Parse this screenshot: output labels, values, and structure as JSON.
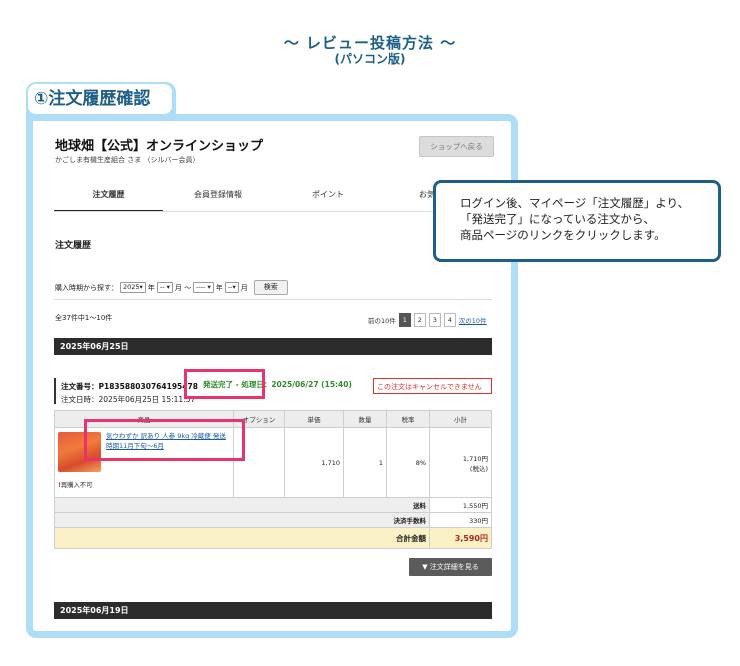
{
  "header": {
    "title": "～ レビュー投稿方法 ～",
    "subtitle": "(パソコン版)"
  },
  "step_label": "①注文履歴確認",
  "shop": {
    "title": "地球畑【公式】オンラインショップ",
    "subtitle": "かごしま有機生産組合 さま （シルバー会員）",
    "back_button": "ショップへ戻る",
    "tabs": [
      "注文履歴",
      "会員登録情報",
      "ポイント",
      "お気"
    ],
    "section_title": "注文履歴",
    "search": {
      "label": "購入時期から探す：",
      "year": "2025",
      "year_suffix": "年",
      "month_from": "--",
      "month_suffix": "月 〜",
      "year_to": "----",
      "month_to": "--",
      "button": "検索"
    },
    "count_text": "全37件中1〜10件",
    "pager": {
      "prev": "前の10件",
      "pages": [
        "1",
        "2",
        "3",
        "4"
      ],
      "next": "次の10件"
    },
    "dates": [
      "2025年06月25日",
      "2025年06月19日"
    ],
    "order": {
      "number": "注文番号：P183588030764195478",
      "date": "注文日時：2025年06月25日 15:11:57",
      "status": "発送完了 - 処理日：2025/06/27 (15:40)",
      "cancel_note": "この注文はキャンセルできません",
      "table_headers": [
        "商品",
        "オプション",
        "単価",
        "数量",
        "税率",
        "小計"
      ],
      "item": {
        "name": "気ウわずか 訳あり 人参 9kg 冷蔵便 発送時期11月下旬〜6月",
        "reorder_mark": "!",
        "reorder_text": "再購入不可",
        "option": "",
        "unit_price": "1,710",
        "quantity": "1",
        "tax_rate": "8%",
        "subtotal": "1,710円",
        "subtotal_note": "(税込)"
      },
      "shipping_label": "送料",
      "shipping_value": "1,550円",
      "fee_label": "決済手数料",
      "fee_value": "330円",
      "total_label": "合計金額",
      "total_value": "3,590円",
      "detail_button": "▼ 注文詳細を見る"
    }
  },
  "callout": {
    "line1": "ログイン後、マイページ「注文履歴」より、",
    "line2": "「発送完了」になっている注文から、",
    "line3": "商品ページのリンクをクリックします。"
  },
  "colors": {
    "frame": "#aedef7",
    "heading": "#1d5f87",
    "highlight": "#e8336c",
    "status_green": "#2e8b2e",
    "total_bg": "#fbf1c7",
    "total_text": "#b0281f"
  }
}
